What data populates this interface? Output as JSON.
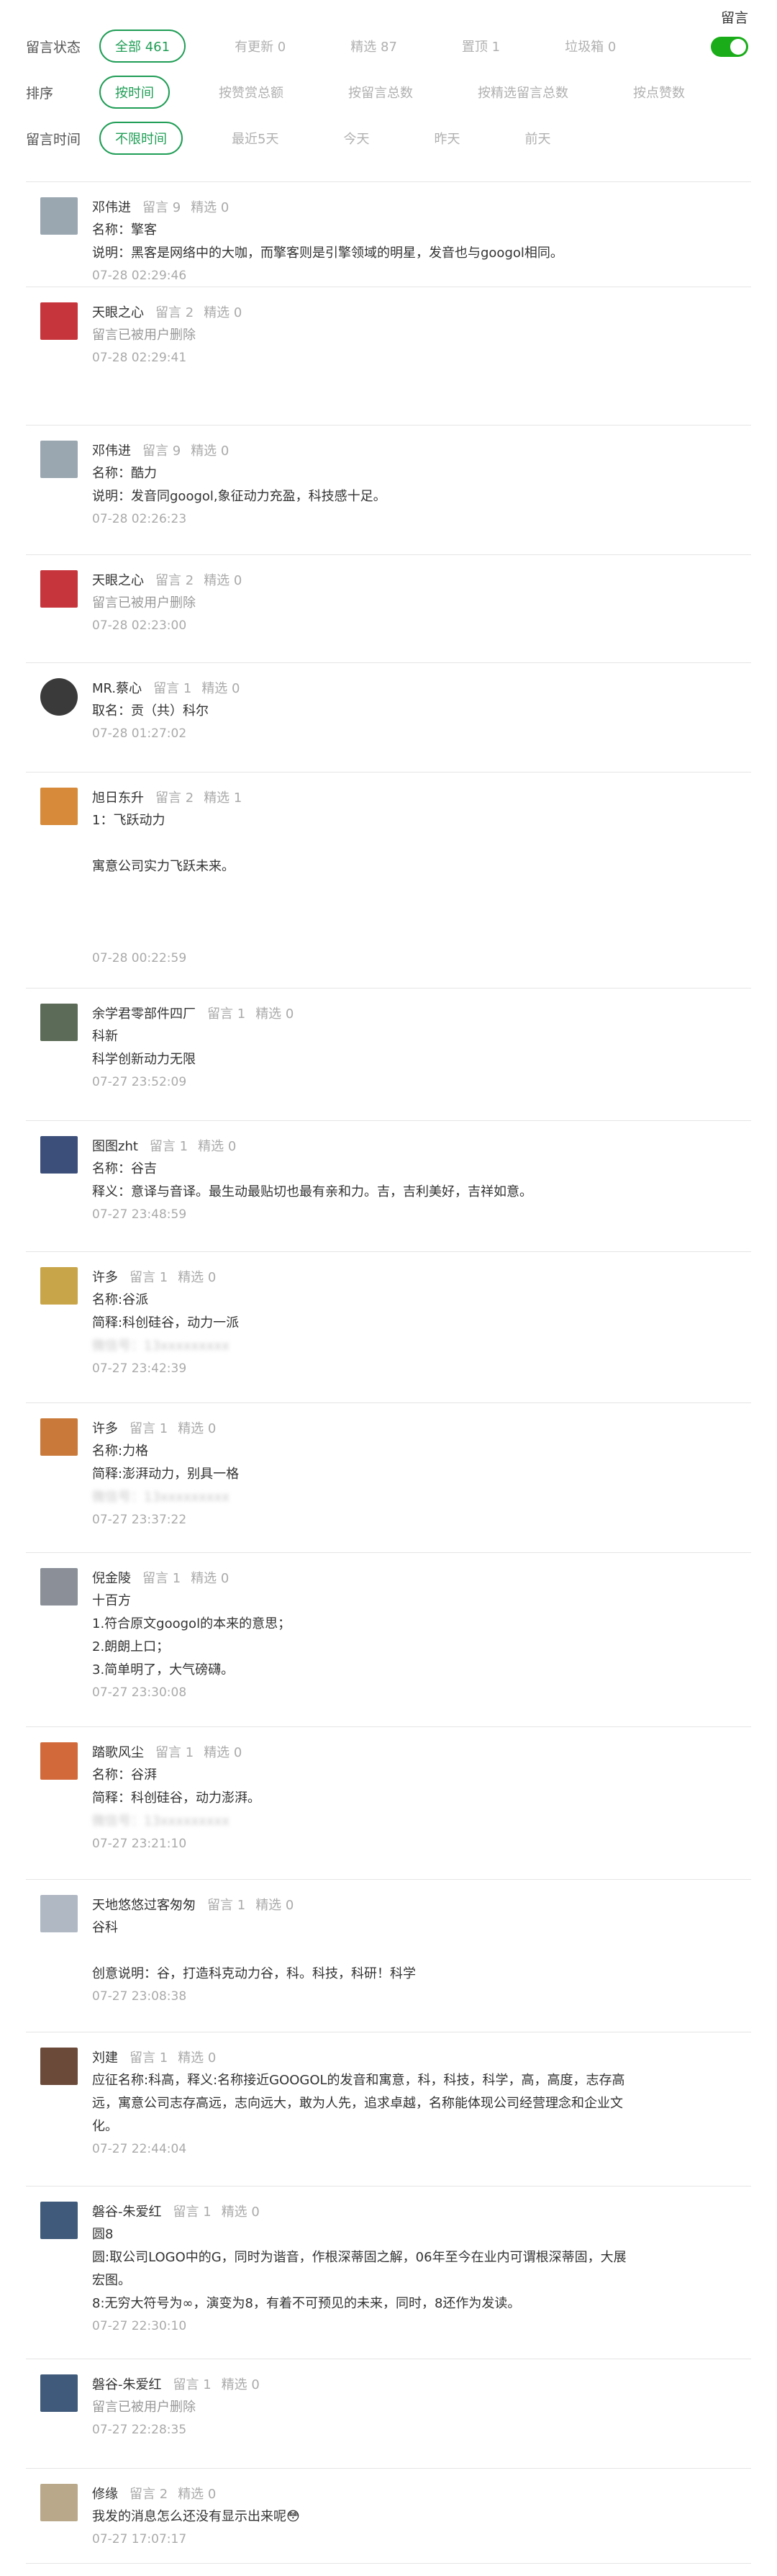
{
  "filters": {
    "status": {
      "label": "留言状态",
      "options": [
        "全部 461",
        "有更新 0",
        "精选 87",
        "置顶 1",
        "垃圾箱 0"
      ],
      "active": 0
    },
    "sort": {
      "label": "排序",
      "options": [
        "按时间",
        "按赞赏总额",
        "按留言总数",
        "按精选留言总数",
        "按点赞数"
      ],
      "active": 0
    },
    "time": {
      "label": "留言时间",
      "options": [
        "不限时间",
        "最近5天",
        "今天",
        "昨天",
        "前天"
      ],
      "active": 0
    },
    "toggle": {
      "label": "留言",
      "on": true
    }
  },
  "comments": [
    {
      "user": "邓伟进",
      "stat1": "留言 9",
      "stat2": "精选 0",
      "lines": [
        "名称：擎客",
        "说明：黑客是网络中的大咖，而擎客则是引擎领域的明星，发音也与googol相同。"
      ],
      "time": "07-28 02:29:46",
      "avatar_color": "#9aa7b0"
    },
    {
      "user": "天眼之心",
      "stat1": "留言 2",
      "stat2": "精选 0",
      "lines": [
        "留言已被用户删除"
      ],
      "deleted": true,
      "time": "07-28 02:29:41",
      "avatar_color": "#c7353c"
    },
    {
      "user": "邓伟进",
      "stat1": "留言 9",
      "stat2": "精选 0",
      "lines": [
        "名称：酷力",
        "说明：发音同googol,象征动力充盈，科技感十足。"
      ],
      "time": "07-28 02:26:23",
      "avatar_color": "#9aa7b0"
    },
    {
      "user": "天眼之心",
      "stat1": "留言 2",
      "stat2": "精选 0",
      "lines": [
        "留言已被用户删除"
      ],
      "deleted": true,
      "time": "07-28 02:23:00",
      "avatar_color": "#c7353c"
    },
    {
      "user": "MR.蔡心",
      "stat1": "留言 1",
      "stat2": "精选 0",
      "lines": [
        "取名：贡（共）科尔"
      ],
      "time": "07-28 01:27:02",
      "avatar_color": "#3a3a3a"
    },
    {
      "user": "旭日东升",
      "stat1": "留言 2",
      "stat2": "精选 1",
      "lines": [
        "1：飞跃动力",
        "",
        "寓意公司实力飞跃未来。",
        "",
        "",
        ""
      ],
      "time": "07-28 00:22:59",
      "avatar_color": "#d68a3a"
    },
    {
      "user": "余学君零部件四厂",
      "stat1": "留言 1",
      "stat2": "精选 0",
      "lines": [
        "科新",
        "科学创新动力无限"
      ],
      "time": "07-27 23:52:09",
      "avatar_color": "#5b6b57"
    },
    {
      "user": "图图zht",
      "stat1": "留言 1",
      "stat2": "精选 0",
      "lines": [
        "名称：谷吉",
        "释义：意译与音译。最生动最贴切也最有亲和力。吉，吉利美好，吉祥如意。"
      ],
      "time": "07-27 23:48:59",
      "avatar_color": "#3c4f7a"
    },
    {
      "user": "许多",
      "stat1": "留言 1",
      "stat2": "精选 0",
      "lines": [
        "名称:谷派",
        "简释:科创硅谷，动力一派",
        "微信号：13xxxxxxxxx"
      ],
      "blurred_last": true,
      "time": "07-27 23:42:39",
      "avatar_color": "#c9a54a"
    },
    {
      "user": "许多",
      "stat1": "留言 1",
      "stat2": "精选 0",
      "lines": [
        "名称:力格",
        "简释:澎湃动力，别具一格",
        "微信号：13xxxxxxxxx"
      ],
      "blurred_last": true,
      "time": "07-27 23:37:22",
      "avatar_color": "#c97a3a"
    },
    {
      "user": "倪金陵",
      "stat1": "留言 1",
      "stat2": "精选 0",
      "lines": [
        "十百方",
        "1.符合原文googol的本来的意思；",
        "2.朗朗上口；",
        "3.简单明了，大气磅礴。"
      ],
      "time": "07-27 23:30:08",
      "avatar_color": "#8a8f98"
    },
    {
      "user": "踏歌风尘",
      "stat1": "留言 1",
      "stat2": "精选 0",
      "lines": [
        "名称：谷湃",
        "简释：科创硅谷，动力澎湃。",
        "微信号：13xxxxxxxxx"
      ],
      "blurred_last": true,
      "time": "07-27 23:21:10",
      "avatar_color": "#d2693a"
    },
    {
      "user": "天地悠悠过客匆匆",
      "stat1": "留言 1",
      "stat2": "精选 0",
      "lines": [
        "谷科",
        "",
        "创意说明：谷，打造科克动力谷，科。科技，科研！科学"
      ],
      "time": "07-27 23:08:38",
      "avatar_color": "#b0b8c4"
    },
    {
      "user": "刘建",
      "stat1": "留言 1",
      "stat2": "精选 0",
      "lines": [
        "应征名称:科高，释义:名称接近GOOGOL的发音和寓意，科，科技，科学，高，高度，志存高",
        "远，寓意公司志存高远，志向远大，敢为人先，追求卓越，名称能体现公司经营理念和企业文",
        "化。"
      ],
      "time": "07-27 22:44:04",
      "avatar_color": "#6b4a3a"
    },
    {
      "user": "磐谷-朱爱红",
      "stat1": "留言 1",
      "stat2": "精选 0",
      "lines": [
        "圆8",
        "圆:取公司LOGO中的G，同时为谐音，作根深蒂固之解，06年至今在业内可谓根深蒂固，大展",
        "宏图。",
        "8:无穷大符号为∞，演变为8，有着不可预见的未来，同时，8还作为发读。"
      ],
      "time": "07-27 22:30:10",
      "avatar_color": "#3f5a7a"
    },
    {
      "user": "磐谷-朱爱红",
      "stat1": "留言 1",
      "stat2": "精选 0",
      "lines": [
        "留言已被用户删除"
      ],
      "deleted": true,
      "time": "07-27 22:28:35",
      "avatar_color": "#3f5a7a"
    },
    {
      "user": "修缘",
      "stat1": "留言 2",
      "stat2": "精选 0",
      "lines": [
        "我发的消息怎么还没有显示出来呢😳"
      ],
      "time": "07-27 17:07:17",
      "avatar_color": "#b9a98a"
    }
  ]
}
